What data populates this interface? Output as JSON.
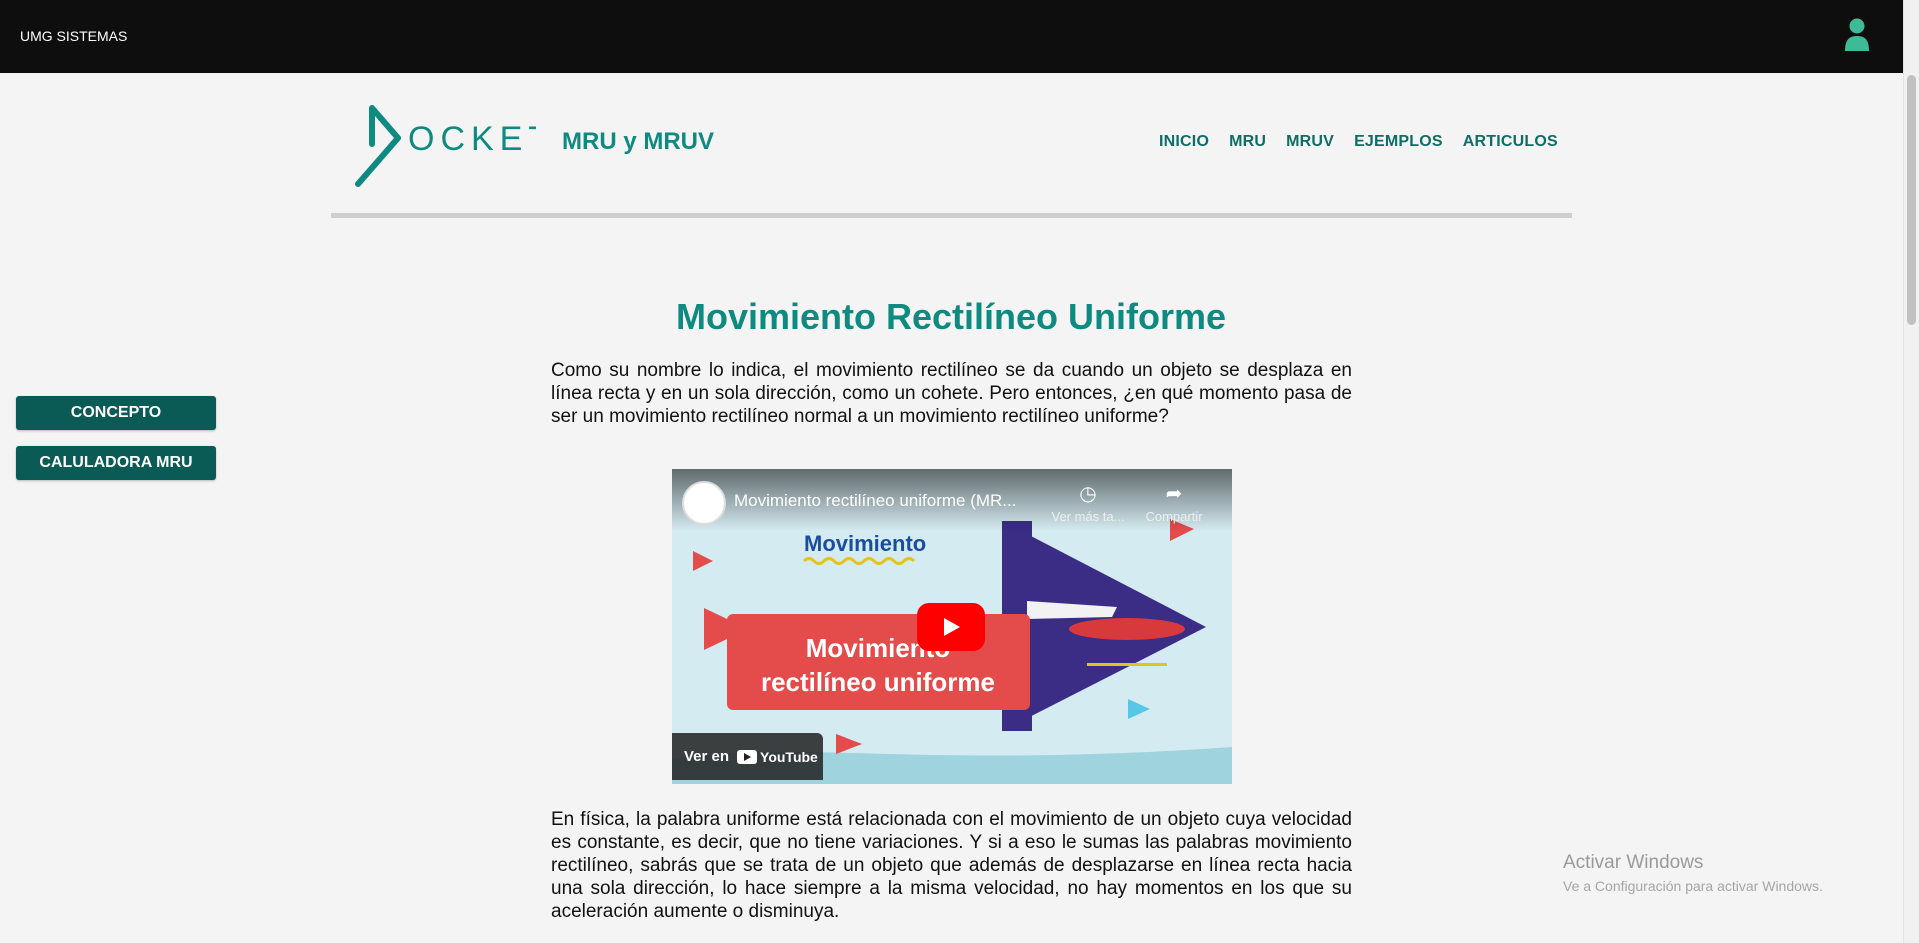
{
  "topbar": {
    "brand": "UMG SISTEMAS"
  },
  "header": {
    "logo_text": "OCKET",
    "title": "MRU y MRUV",
    "nav": [
      "INICIO",
      "MRU",
      "MRUV",
      "EJEMPLOS",
      "ARTICULOS"
    ]
  },
  "sidebar": {
    "buttons": [
      "CONCEPTO",
      "CALULADORA MRU"
    ]
  },
  "main": {
    "heading": "Movimiento Rectilíneo Uniforme",
    "paragraph1": "Como su nombre lo indica, el movimiento rectilíneo se da cuando un objeto se desplaza en línea recta y en un sola dirección, como un cohete. Pero entonces, ¿en qué momento pasa de ser un movimiento rectilíneo normal a un movimiento rectilíneo uniforme?",
    "paragraph2": "En física, la palabra uniforme está relacionada con el movimiento de un objeto cuya velocidad es constante, es decir, que no tiene variaciones. Y si a eso le sumas las palabras movimiento rectilíneo, sabrás que se trata de un objeto que además de desplazarse en línea recta hacia una sola dirección, lo hace siempre a la misma velocidad, no hay momentos en los que su aceleración aumente o disminuya."
  },
  "video": {
    "title": "Movimiento rectilíneo uniforme (MR...",
    "watch_later": "Ver más ta...",
    "share": "Compartir",
    "thumbnail_word": "Movimiento",
    "thumbnail_banner_line1": "Movimiento",
    "thumbnail_banner_line2": "rectilíneo uniforme",
    "watch_on": "Ver en",
    "youtube": "YouTube"
  },
  "watermark": {
    "title": "Activar Windows",
    "subtitle": "Ve a Configuración para activar Windows."
  },
  "colors": {
    "accent": "#0f8a80",
    "nav": "#0e6e66",
    "button": "#0a5a55",
    "topbar": "#0e0e0e",
    "user_icon": "#3dbb96"
  }
}
